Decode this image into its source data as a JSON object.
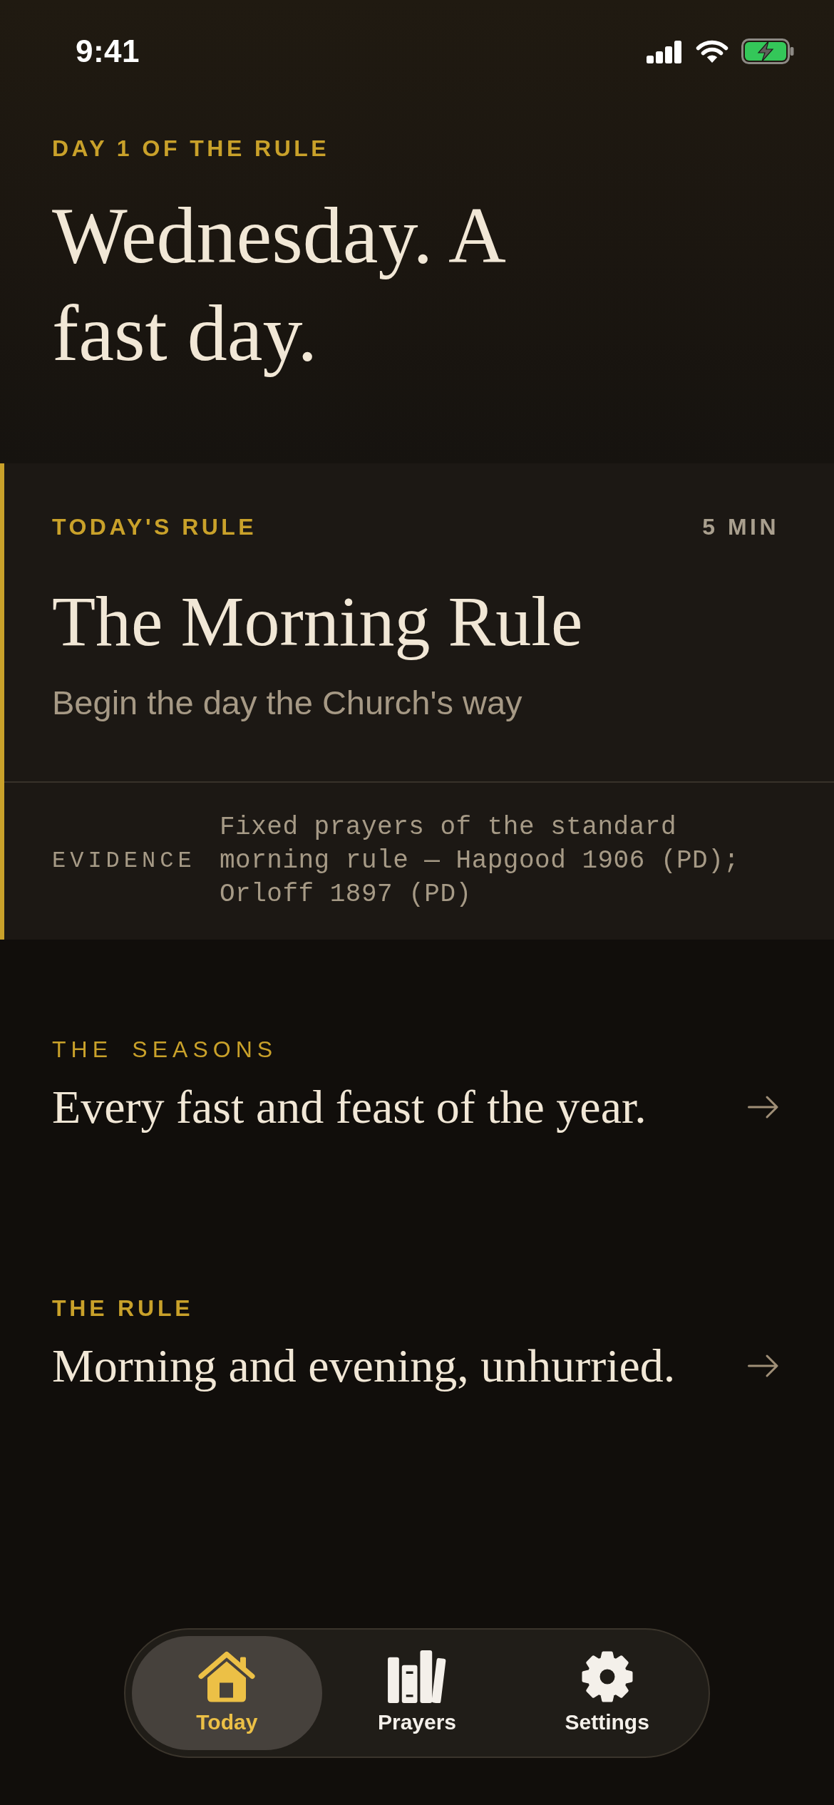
{
  "status_bar": {
    "time": "9:41"
  },
  "header": {
    "eyebrow": "DAY 1 OF THE RULE",
    "title": "Wednesday. A fast day."
  },
  "todays_rule": {
    "label": "TODAY'S RULE",
    "duration": "5 MIN",
    "title": "The Morning Rule",
    "subtitle": "Begin the day the Church's way",
    "evidence": {
      "label": "EVIDENCE",
      "text": "Fixed prayers of the standard morning rule — Hapgood 1906 (PD); Orloff 1897 (PD)"
    }
  },
  "sections": [
    {
      "kind": "light",
      "label": "THE SEASONS",
      "title": "Every fast and feast of the year."
    },
    {
      "kind": "bold",
      "label": "THE RULE",
      "title": "Morning and evening, unhurried."
    }
  ],
  "tab_bar": {
    "tabs": [
      {
        "label": "Today",
        "selected": true
      },
      {
        "label": "Prayers",
        "selected": false
      },
      {
        "label": "Settings",
        "selected": false
      }
    ]
  }
}
